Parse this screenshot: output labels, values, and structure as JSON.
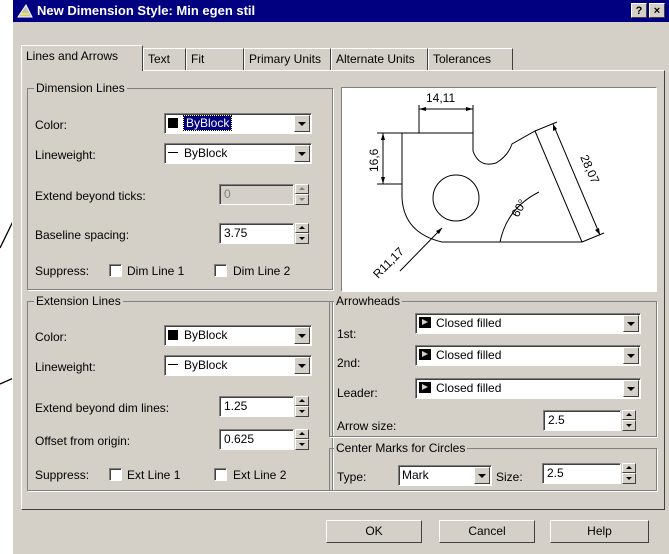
{
  "window": {
    "title": "New Dimension Style: Min egen stil",
    "help_glyph": "?",
    "close_glyph": "×"
  },
  "tabs": [
    {
      "label": "Lines and Arrows",
      "active": true
    },
    {
      "label": "Text"
    },
    {
      "label": "Fit"
    },
    {
      "label": "Primary Units"
    },
    {
      "label": "Alternate Units"
    },
    {
      "label": "Tolerances"
    }
  ],
  "dimension_lines": {
    "title": "Dimension Lines",
    "color_label": "Color:",
    "color_value": "ByBlock",
    "lineweight_label": "Lineweight:",
    "lineweight_value": "ByBlock",
    "extend_label": "Extend beyond ticks:",
    "extend_value": "0",
    "baseline_label": "Baseline spacing:",
    "baseline_value": "3.75",
    "suppress_label": "Suppress:",
    "suppress_1": "Dim Line 1",
    "suppress_2": "Dim Line 2"
  },
  "extension_lines": {
    "title": "Extension Lines",
    "color_label": "Color:",
    "color_value": "ByBlock",
    "lineweight_label": "Lineweight:",
    "lineweight_value": "ByBlock",
    "extend_label": "Extend beyond dim lines:",
    "extend_value": "1.25",
    "offset_label": "Offset from origin:",
    "offset_value": "0.625",
    "suppress_label": "Suppress:",
    "suppress_1": "Ext Line 1",
    "suppress_2": "Ext Line 2"
  },
  "preview": {
    "dim_top": "14,11",
    "dim_left": "16,6",
    "dim_right": "28,07",
    "dim_angle": "60°",
    "dim_radius": "R11,17"
  },
  "arrowheads": {
    "title": "Arrowheads",
    "first_label": "1st:",
    "first_value": "Closed filled",
    "second_label": "2nd:",
    "second_value": "Closed filled",
    "leader_label": "Leader:",
    "leader_value": "Closed filled",
    "size_label": "Arrow size:",
    "size_value": "2.5"
  },
  "center_marks": {
    "title": "Center Marks for Circles",
    "type_label": "Type:",
    "type_value": "Mark",
    "size_label": "Size:",
    "size_value": "2.5"
  },
  "buttons": {
    "ok": "OK",
    "cancel": "Cancel",
    "help": "Help"
  },
  "colors": {
    "titlebar": "#000080",
    "dialog": "#d4d0c8",
    "selection": "#000080"
  }
}
